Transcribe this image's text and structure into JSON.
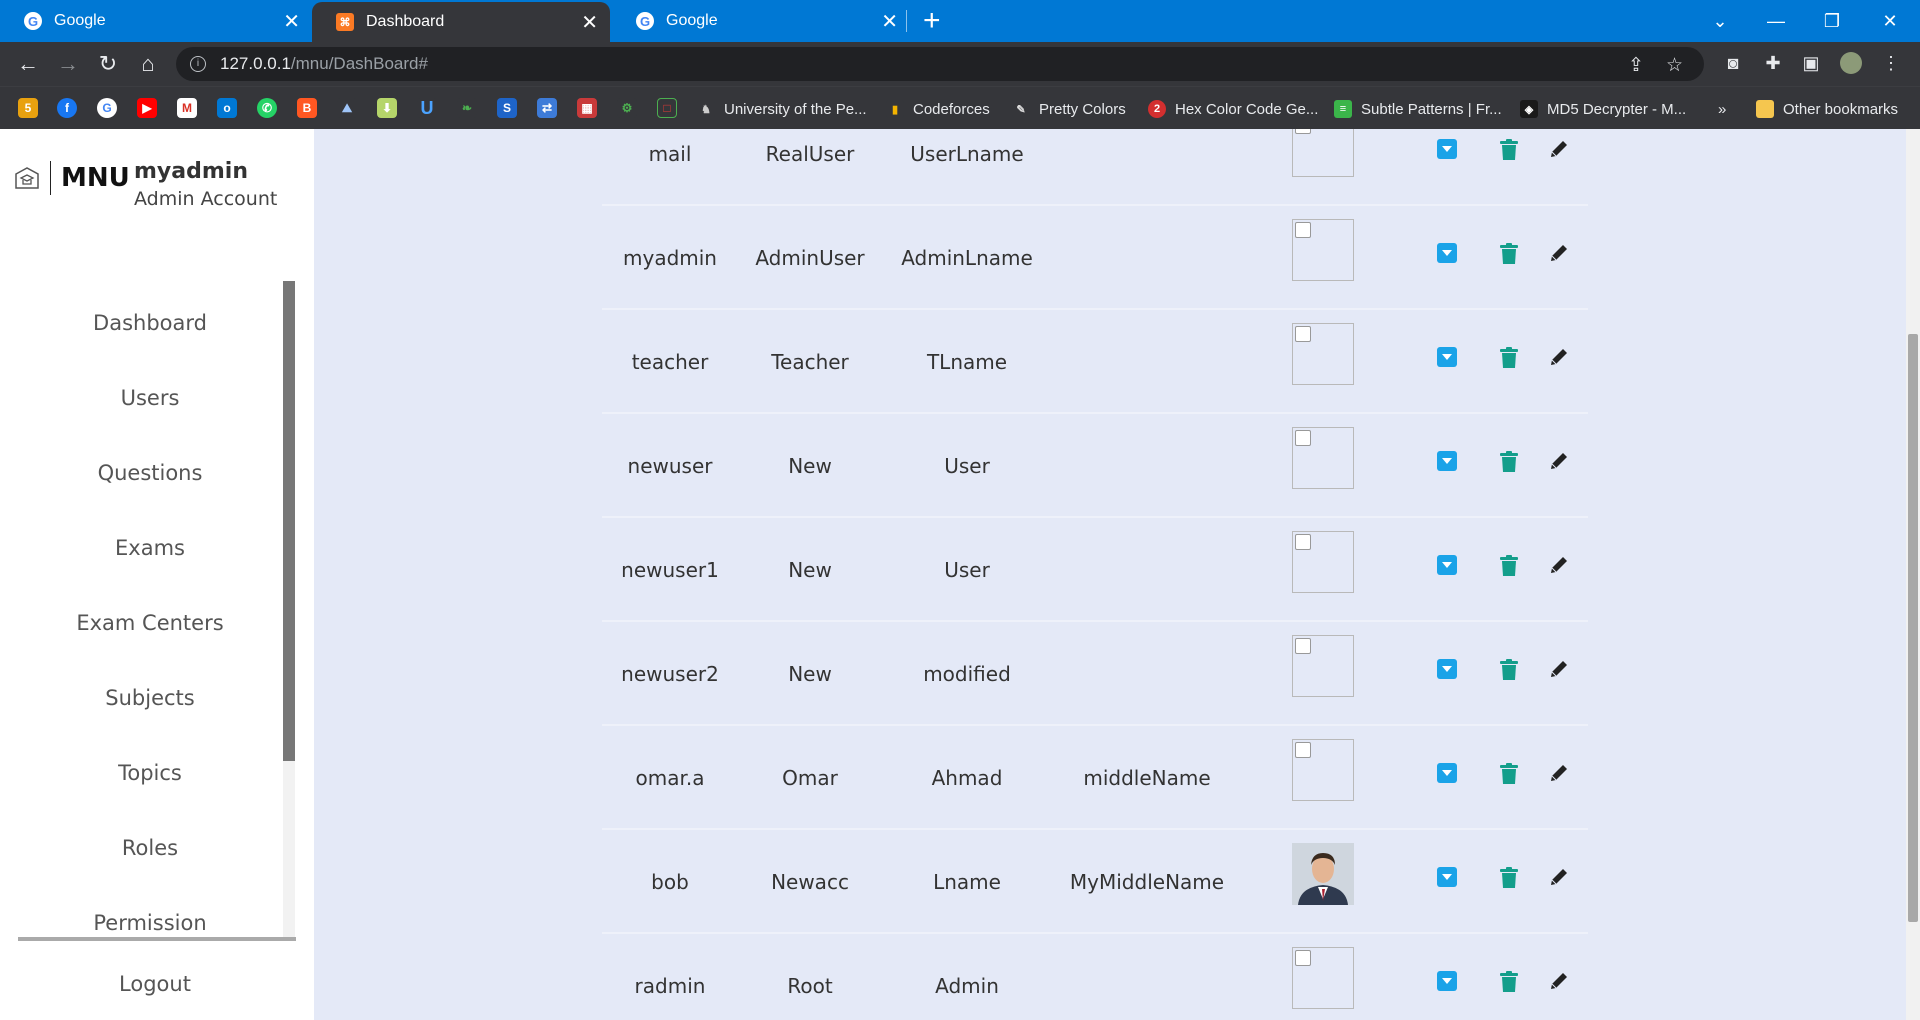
{
  "browser": {
    "tabs": [
      {
        "title": "Google",
        "favicon": "google-icon"
      },
      {
        "title": "Dashboard",
        "favicon": "xampp-icon"
      },
      {
        "title": "Google",
        "favicon": "google-icon"
      }
    ],
    "url_host": "127.0.0.1",
    "url_path": "/mnu/DashBoard#",
    "bookmarks": [
      {
        "label": "University of the Pe...",
        "icon": "university-icon"
      },
      {
        "label": "Codeforces",
        "icon": "codeforces-icon"
      },
      {
        "label": "Pretty Colors",
        "icon": "eyedropper-icon"
      },
      {
        "label": "Hex Color Code Ge...",
        "icon": "hex-color-icon"
      },
      {
        "label": "Subtle Patterns | Fr...",
        "icon": "subtle-patterns-icon"
      },
      {
        "label": "MD5 Decrypter - M...",
        "icon": "md5-icon"
      }
    ],
    "bookmarks_overflow": "»",
    "other_bookmarks": "Other bookmarks",
    "accent_color": "#0078d4"
  },
  "sidebar": {
    "brand": "MNU",
    "username": "myadmin",
    "role": "Admin Account",
    "menu": [
      "Dashboard",
      "Users",
      "Questions",
      "Exams",
      "Exam Centers",
      "Subjects",
      "Topics",
      "Roles",
      "Permission"
    ],
    "logout": "Logout"
  },
  "users_table": {
    "rows": [
      {
        "username": "mail",
        "first_name": "RealUser",
        "last_name": "UserLname",
        "middle_name": "",
        "has_photo": false
      },
      {
        "username": "myadmin",
        "first_name": "AdminUser",
        "last_name": "AdminLname",
        "middle_name": "",
        "has_photo": false
      },
      {
        "username": "teacher",
        "first_name": "Teacher",
        "last_name": "TLname",
        "middle_name": "",
        "has_photo": false
      },
      {
        "username": "newuser",
        "first_name": "New",
        "last_name": "User",
        "middle_name": "",
        "has_photo": false
      },
      {
        "username": "newuser1",
        "first_name": "New",
        "last_name": "User",
        "middle_name": "",
        "has_photo": false
      },
      {
        "username": "newuser2",
        "first_name": "New",
        "last_name": "modified",
        "middle_name": "",
        "has_photo": false
      },
      {
        "username": "omar.a",
        "first_name": "Omar",
        "last_name": "Ahmad",
        "middle_name": "middleName",
        "has_photo": false
      },
      {
        "username": "bob",
        "first_name": "Newacc",
        "last_name": "Lname",
        "middle_name": "MyMiddleName",
        "has_photo": true
      },
      {
        "username": "radmin",
        "first_name": "Root",
        "last_name": "Admin",
        "middle_name": "",
        "has_photo": false
      }
    ],
    "action_icons": [
      "expand-down-icon",
      "trash-icon",
      "pencil-icon"
    ],
    "colors": {
      "expand": "#1aa3e8",
      "delete": "#139e8b",
      "edit": "#222222"
    }
  },
  "fab": {
    "icon": "plus-icon",
    "color": "#139e8b"
  }
}
